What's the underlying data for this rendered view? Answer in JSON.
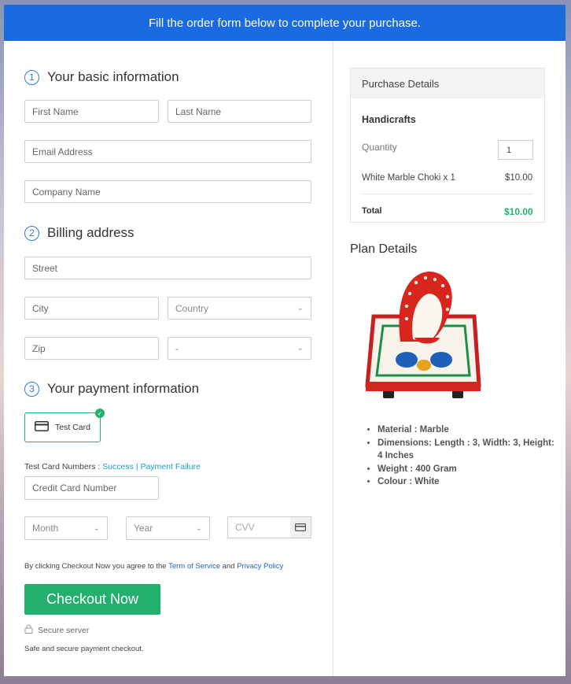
{
  "banner": {
    "text": "Fill the order form below to complete your purchase."
  },
  "basic": {
    "number": "1",
    "title": "Your basic information",
    "first_name": "First Name",
    "last_name": "Last Name",
    "email": "Email Address",
    "company": "Company Name"
  },
  "billing": {
    "number": "2",
    "title": "Billing address",
    "street": "Street",
    "city": "City",
    "country": "Country",
    "zip": "Zip",
    "state": "-"
  },
  "payment": {
    "number": "3",
    "title": "Your payment information",
    "test_card_label": "Test Card",
    "test_numbers_label": "Test Card Numbers :",
    "success": "Success",
    "separator": "|",
    "failure": "Payment Failure",
    "card_number": "Credit Card Number",
    "month": "Month",
    "year": "Year",
    "cvv": "CVV"
  },
  "terms": {
    "prefix": "By clicking Checkout Now you agree to the",
    "term_link": "Term of Service",
    "and": "and",
    "privacy_link": "Privacy Policy"
  },
  "checkout": {
    "button": "Checkout Now",
    "secure": "Secure server",
    "safe": "Safe and secure payment checkout."
  },
  "purchase": {
    "title": "Purchase Details",
    "category": "Handicrafts",
    "quantity_label": "Quantity",
    "quantity_value": "1",
    "item": "White Marble Choki x 1",
    "item_price": "$10.00",
    "total_label": "Total",
    "total_value": "$10.00"
  },
  "plan": {
    "title": "Plan Details",
    "details": [
      "Material : Marble",
      "Dimensions: Length : 3, Width: 3, Height: 4 Inches",
      "Weight : 400 Gram",
      "Colour : White"
    ]
  },
  "colors": {
    "accent": "#1b6be0",
    "success": "#23b06e",
    "link": "#16a3b8"
  },
  "icons": [
    "credit-card-icon",
    "check-icon",
    "chevron-down-icon",
    "lock-icon",
    "cvv-card-icon"
  ]
}
